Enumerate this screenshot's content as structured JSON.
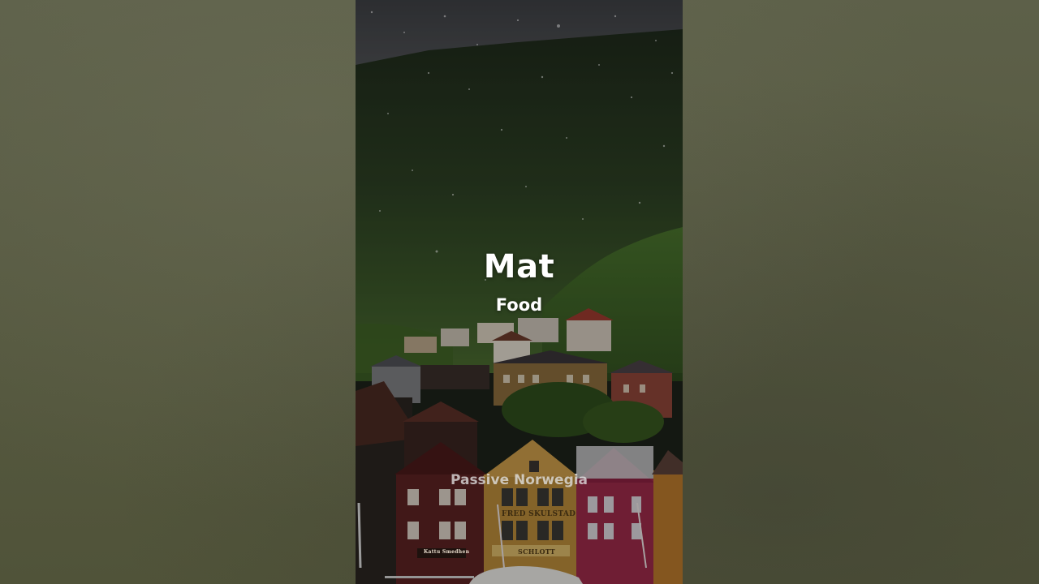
{
  "overlay": {
    "title": "Mat",
    "subtitle": "Food",
    "watermark": "Passive Norwegia"
  },
  "scene": {
    "shop_sign": "FRED SKULSTAD",
    "shop_sign_lower": "SCHLOTT",
    "left_sign": "Kattu Smedhen"
  },
  "colors": {
    "side_background": "#575a44",
    "mountain": "#2a3a22",
    "sky": "#4a4c4f"
  }
}
